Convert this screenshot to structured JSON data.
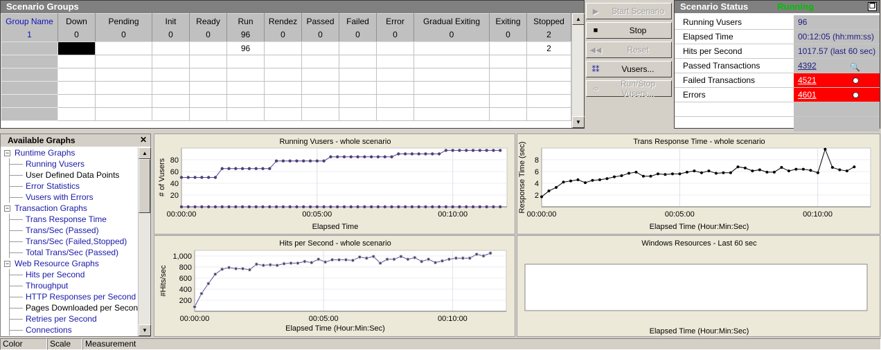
{
  "groups": {
    "title": "Scenario Groups",
    "columns": [
      {
        "label": "Group Name",
        "value": "1"
      },
      {
        "label": "Down",
        "value": "0"
      },
      {
        "label": "Pending",
        "value": "0"
      },
      {
        "label": "Init",
        "value": "0"
      },
      {
        "label": "Ready",
        "value": "0"
      },
      {
        "label": "Run",
        "value": "96"
      },
      {
        "label": "Rendez",
        "value": "0"
      },
      {
        "label": "Passed",
        "value": "0"
      },
      {
        "label": "Failed",
        "value": "0"
      },
      {
        "label": "Error",
        "value": "0"
      },
      {
        "label": "Gradual Exiting",
        "value": "0"
      },
      {
        "label": "Exiting",
        "value": "0"
      },
      {
        "label": "Stopped",
        "value": "2"
      }
    ],
    "row1": {
      "run": "96",
      "stopped": "2"
    }
  },
  "buttons": {
    "start": "Start Scenario",
    "stop": "Stop",
    "reset": "Reset",
    "vusers": "Vusers...",
    "runstop": "Run/Stop Vusers..."
  },
  "status": {
    "title": "Scenario Status",
    "state": "Running",
    "state_color": "#00c000",
    "rows": [
      {
        "label": "Running Vusers",
        "value": "96"
      },
      {
        "label": "Elapsed Time",
        "value": "00:12:05 (hh:mm:ss)"
      },
      {
        "label": "Hits per Second",
        "value": "1017.57 (last 60 sec)"
      },
      {
        "label": "Passed Transactions",
        "value": "4392"
      },
      {
        "label": "Failed Transactions",
        "value": "4521"
      },
      {
        "label": "Errors",
        "value": "4601"
      }
    ]
  },
  "available": {
    "title": "Available Graphs",
    "items": [
      {
        "label": "Runtime Graphs",
        "cat": true
      },
      {
        "label": "Running Vusers"
      },
      {
        "label": "User Defined Data Points",
        "black": true
      },
      {
        "label": "Error Statistics"
      },
      {
        "label": "Vusers with Errors"
      },
      {
        "label": "Transaction Graphs",
        "cat": true
      },
      {
        "label": "Trans Response Time"
      },
      {
        "label": "Trans/Sec (Passed)"
      },
      {
        "label": "Trans/Sec (Failed,Stopped)"
      },
      {
        "label": "Total Trans/Sec (Passed)"
      },
      {
        "label": "Web Resource Graphs",
        "cat": true
      },
      {
        "label": "Hits per Second"
      },
      {
        "label": "Throughput"
      },
      {
        "label": "HTTP Responses per Second"
      },
      {
        "label": "Pages Downloaded per Second",
        "black": true
      },
      {
        "label": "Retries per Second"
      },
      {
        "label": "Connections"
      }
    ]
  },
  "statusbar": {
    "color": "Color",
    "scale": "Scale",
    "measurement": "Measurement"
  },
  "chart_data": [
    {
      "type": "line",
      "title": "Running Vusers - whole scenario",
      "xlabel": "Elapsed Time",
      "ylabel": "# of Vusers",
      "xticks": [
        "00:00:00",
        "00:05:00",
        "00:10:00"
      ],
      "xtick_sec": [
        0,
        300,
        600
      ],
      "xlim": [
        0,
        720
      ],
      "ylim": [
        0,
        100
      ],
      "yticks": [
        20,
        40,
        60,
        80
      ],
      "x_start": 0,
      "x_step": 15,
      "series": [
        {
          "name": "Run",
          "color": "#5040a0",
          "values": [
            50,
            50,
            50,
            50,
            50,
            50,
            65,
            65,
            65,
            65,
            65,
            65,
            65,
            65,
            78,
            78,
            78,
            78,
            78,
            78,
            78,
            78,
            85,
            85,
            85,
            85,
            85,
            85,
            85,
            85,
            85,
            85,
            90,
            90,
            90,
            90,
            90,
            90,
            90,
            96,
            96,
            96,
            96,
            96,
            96,
            96,
            96,
            96
          ]
        },
        {
          "name": "Stopped",
          "color": "#5040a0",
          "values": [
            0,
            0,
            0,
            0,
            0,
            0,
            0,
            0,
            0,
            0,
            0,
            0,
            0,
            0,
            0,
            0,
            0,
            0,
            0,
            0,
            0,
            0,
            0,
            0,
            0,
            0,
            0,
            0,
            0,
            0,
            0,
            0,
            0,
            0,
            0,
            0,
            0,
            0,
            0,
            0,
            0,
            0,
            0,
            0,
            0,
            0,
            0,
            0
          ]
        }
      ]
    },
    {
      "type": "line",
      "title": "Trans Response Time - whole scenario",
      "xlabel": "Elapsed Time (Hour:Min:Sec)",
      "ylabel": "Response Time (sec)",
      "xticks": [
        "00:00:00",
        "00:05:00",
        "00:10:00"
      ],
      "xtick_sec": [
        0,
        300,
        600
      ],
      "xlim": [
        0,
        715
      ],
      "ylim": [
        0,
        10
      ],
      "yticks": [
        2,
        4,
        6,
        8
      ],
      "x_start": 0,
      "x_step": 15.8,
      "series": [
        {
          "name": "Transactions",
          "color": "#000000",
          "values": [
            1.7,
            2.7,
            3.3,
            4.2,
            4.4,
            4.6,
            4.1,
            4.5,
            4.6,
            4.8,
            5.1,
            5.3,
            5.7,
            5.9,
            5.2,
            5.2,
            5.6,
            5.5,
            5.6,
            5.6,
            5.9,
            6.1,
            5.8,
            6.1,
            5.7,
            5.8,
            5.8,
            6.8,
            6.6,
            6.1,
            6.3,
            5.9,
            5.9,
            6.7,
            6.1,
            6.4,
            6.4,
            6.2,
            5.8,
            9.8,
            6.7,
            6.3,
            6.1,
            6.8
          ]
        }
      ]
    },
    {
      "type": "line",
      "title": "Hits per Second - whole scenario",
      "xlabel": "Elapsed Time (Hour:Min:Sec)",
      "ylabel": "#Hits/sec",
      "xticks": [
        "00:00:00",
        "00:05:00",
        "00:10:00"
      ],
      "xtick_sec": [
        0,
        300,
        600
      ],
      "xlim": [
        0,
        725
      ],
      "ylim": [
        0,
        1100
      ],
      "yticks": [
        200,
        400,
        600,
        800,
        1000
      ],
      "ytick_labels": [
        "200",
        "400",
        "600",
        "800",
        "1,000"
      ],
      "x_start": 0,
      "x_step": 16,
      "series": [
        {
          "name": "Hits",
          "color": "#5050a0",
          "values": [
            80,
            320,
            500,
            670,
            760,
            790,
            770,
            770,
            750,
            850,
            830,
            840,
            830,
            860,
            870,
            870,
            900,
            880,
            940,
            890,
            930,
            930,
            930,
            920,
            980,
            960,
            990,
            870,
            940,
            940,
            990,
            940,
            970,
            900,
            940,
            880,
            910,
            940,
            960,
            960,
            960,
            1030,
            1000,
            1050
          ]
        }
      ]
    },
    {
      "type": "line",
      "title": "Windows Resources - Last 60 sec",
      "xlabel": "Elapsed Time (Hour:Min:Sec)",
      "series": []
    }
  ]
}
